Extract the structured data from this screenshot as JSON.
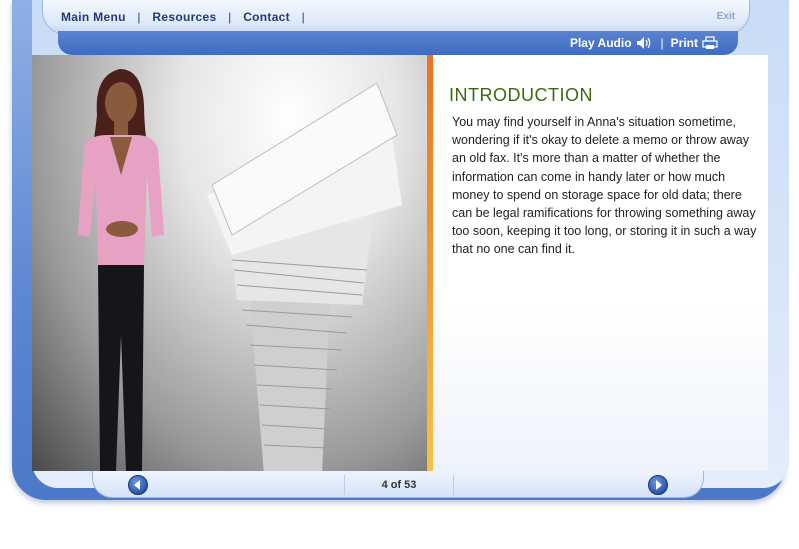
{
  "nav": {
    "main_menu": "Main Menu",
    "resources": "Resources",
    "contact": "Contact",
    "separator": "|",
    "exit": "Exit"
  },
  "toolbar": {
    "play_audio": "Play Audio",
    "print": "Print",
    "separator": "|"
  },
  "content": {
    "heading": "INTRODUCTION",
    "body": "You may find yourself in Anna's situation sometime, wondering if it's okay to delete a memo or throw away an old fax. It's more than a matter of whether the information can come in handy later or how much money to spend on storage space for old data; there can be legal ramifications for throwing something away too soon, keeping it too long, or storing it in such a way that no one can find it."
  },
  "pagination": {
    "counter": "4 of 53",
    "current": 4,
    "total": 53
  },
  "icons": {
    "audio": "speaker-icon",
    "print": "printer-icon",
    "prev": "arrow-left-icon",
    "next": "arrow-right-icon"
  },
  "colors": {
    "frame": "#5d86d2",
    "heading": "#3a6a0f",
    "accent_divider": "#f2a23a",
    "nav_text": "#1f3b7a"
  }
}
